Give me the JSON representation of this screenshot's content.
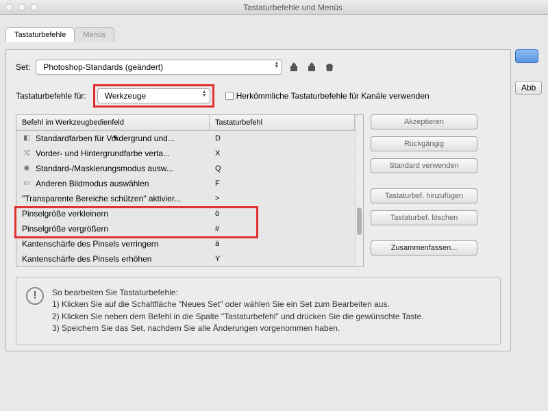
{
  "window": {
    "title": "Tastaturbefehle und Menüs"
  },
  "tabs": {
    "shortcuts": "Tastaturbefehle",
    "menus": "Menüs"
  },
  "set": {
    "label": "Set:",
    "value": "Photoshop-Standards (geändert)"
  },
  "shortcuts_for": {
    "label": "Tastaturbefehle für:",
    "value": "Werkzeuge"
  },
  "legacy_check": {
    "label": "Herkömmliche Tastaturbefehle für Kanäle verwenden"
  },
  "columns": {
    "command": "Befehl im Werkzeugbedienfeld",
    "shortcut": "Tastaturbefehl"
  },
  "rows": [
    {
      "icon": "swatch",
      "label": "Standardfarben für Vordergrund und...",
      "key": "D"
    },
    {
      "icon": "swap",
      "label": "Vorder- und Hintergrundfarbe verta...",
      "key": "X"
    },
    {
      "icon": "mask",
      "label": "Standard-/Maskierungsmodus ausw...",
      "key": "Q"
    },
    {
      "icon": "screen",
      "label": "Anderen Bildmodus auswählen",
      "key": "F"
    },
    {
      "icon": "",
      "label": "\"Transparente Bereiche schützen\" aktivier...",
      "key": ">"
    },
    {
      "icon": "",
      "label": "Pinselgröße verkleinern",
      "key": "ö"
    },
    {
      "icon": "",
      "label": "Pinselgröße vergrößern",
      "key": "#"
    },
    {
      "icon": "",
      "label": "Kantenschärfe des Pinsels verringern",
      "key": "ä"
    },
    {
      "icon": "",
      "label": "Kantenschärfe des Pinsels erhöhen",
      "key": "Y"
    }
  ],
  "buttons": {
    "accept": "Akzeptieren",
    "undo": "Rückgängig",
    "default": "Standard verwenden",
    "add": "Tastaturbef. hinzufügen",
    "delete": "Tastaturbef. löschen",
    "summary": "Zusammenfassen...",
    "cancel": "Abb"
  },
  "help": {
    "title": "So bearbeiten Sie Tastaturbefehle:",
    "l1": "1) Klicken Sie auf die Schaltfläche \"Neues Set\" oder wählen Sie ein Set zum Bearbeiten aus.",
    "l2": "2) Klicken Sie neben dem Befehl in die Spalte \"Tastaturbefehl\" und drücken Sie die gewünschte Taste.",
    "l3": "3) Speichern Sie das Set, nachdem Sie alle Änderungen vorgenommen haben."
  }
}
